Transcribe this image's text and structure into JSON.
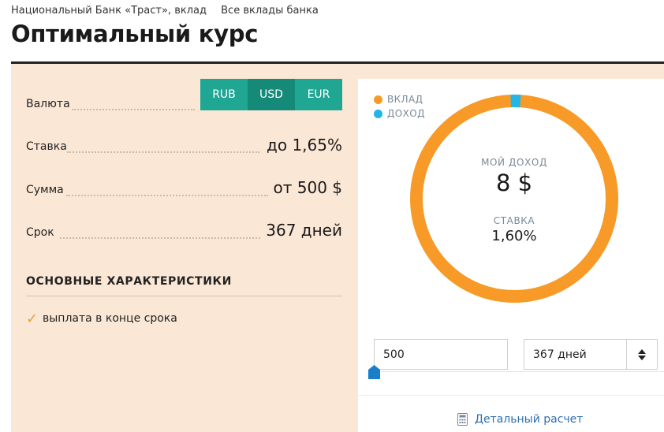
{
  "breadcrumbs": [
    "Национальный Банк «Траст», вклад",
    "Все вклады банка"
  ],
  "title": "Оптимальный курс",
  "currency": {
    "label": "Валюта",
    "options": [
      "RUB",
      "USD",
      "EUR"
    ],
    "selected": "USD"
  },
  "rate": {
    "label": "Ставка",
    "value": "до 1,65%"
  },
  "amount": {
    "label": "Сумма",
    "value": "от 500 $"
  },
  "term": {
    "label": "Срок",
    "value": "367 дней"
  },
  "features": {
    "title": "ОСНОВНЫЕ ХАРАКТЕРИСТИКИ",
    "items": [
      "выплата в конце срока"
    ]
  },
  "chart": {
    "legend": [
      {
        "label": "ВКЛАД",
        "color": "#f79a27"
      },
      {
        "label": "ДОХОД",
        "color": "#22b5e8"
      }
    ],
    "income_label": "МОЙ ДОХОД",
    "income_value": "8 $",
    "rate_label": "СТАВКА",
    "rate_value": "1,60%",
    "deposit": 500,
    "income": 8
  },
  "calculator": {
    "amount_value": "500",
    "term_value": "367 дней",
    "slider_fraction": 0
  },
  "detail_link": "Детальный расчет",
  "icons": {
    "check": "check-icon",
    "spinner": "updown-icon",
    "calc": "calculator-icon"
  }
}
